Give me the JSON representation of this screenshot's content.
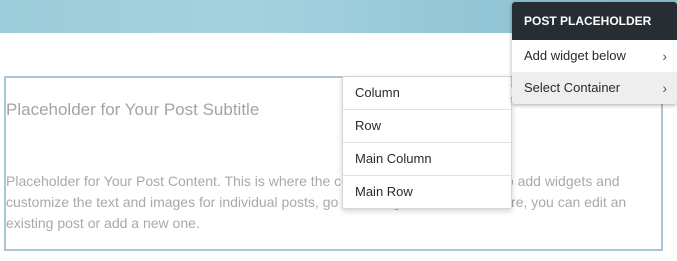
{
  "post": {
    "subtitle": "Placeholder for Your Post Subtitle",
    "content": "Placeholder for Your Post Content. This is where the content of your post goes. To add widgets and customize the text and images for individual posts, go to Manage Posts. From there, you can edit an existing post or add a new one."
  },
  "context_menu": {
    "title": "POST PLACEHOLDER",
    "items": [
      {
        "label": "Add widget below",
        "icon": "chevron-right-icon"
      },
      {
        "label": "Select Container",
        "icon": "chevron-right-icon"
      }
    ]
  },
  "submenu": {
    "items": [
      {
        "label": "Column"
      },
      {
        "label": "Row"
      },
      {
        "label": "Main Column"
      },
      {
        "label": "Main Row"
      }
    ]
  },
  "colors": {
    "banner": "#9ccbd9",
    "menu_header_bg": "#262d33",
    "frame_border": "#a9c6db",
    "placeholder_text": "#a9a9a9"
  }
}
